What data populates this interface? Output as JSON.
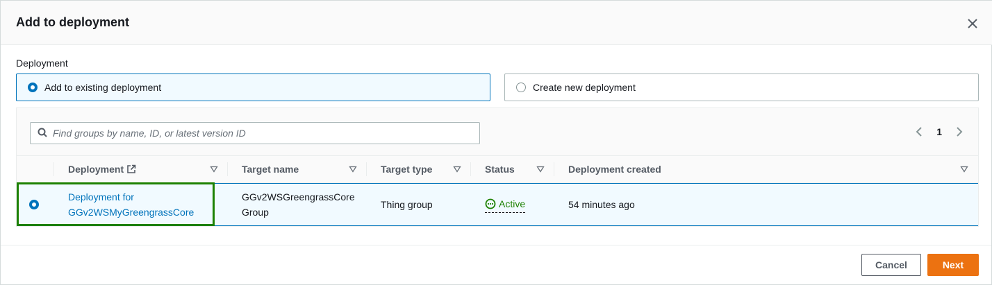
{
  "modal": {
    "title": "Add to deployment"
  },
  "deployment_section": {
    "label": "Deployment",
    "options": [
      {
        "label": "Add to existing deployment",
        "selected": true
      },
      {
        "label": "Create new deployment",
        "selected": false
      }
    ]
  },
  "table": {
    "search_placeholder": "Find groups by name, ID, or latest version ID",
    "page": "1",
    "columns": [
      "Deployment",
      "Target name",
      "Target type",
      "Status",
      "Deployment created"
    ],
    "rows": [
      {
        "selected": true,
        "deployment_line1": "Deployment for",
        "deployment_line2": "GGv2WSMyGreengrassCore",
        "target_name_line1": "GGv2WSGreengrassCore",
        "target_name_line2": "Group",
        "target_type": "Thing group",
        "status": "Active",
        "created": "54 minutes ago"
      }
    ]
  },
  "footer": {
    "cancel_label": "Cancel",
    "next_label": "Next"
  },
  "colors": {
    "accent": "#0073bb",
    "success": "#1d8102",
    "primary_button": "#ec7211"
  }
}
